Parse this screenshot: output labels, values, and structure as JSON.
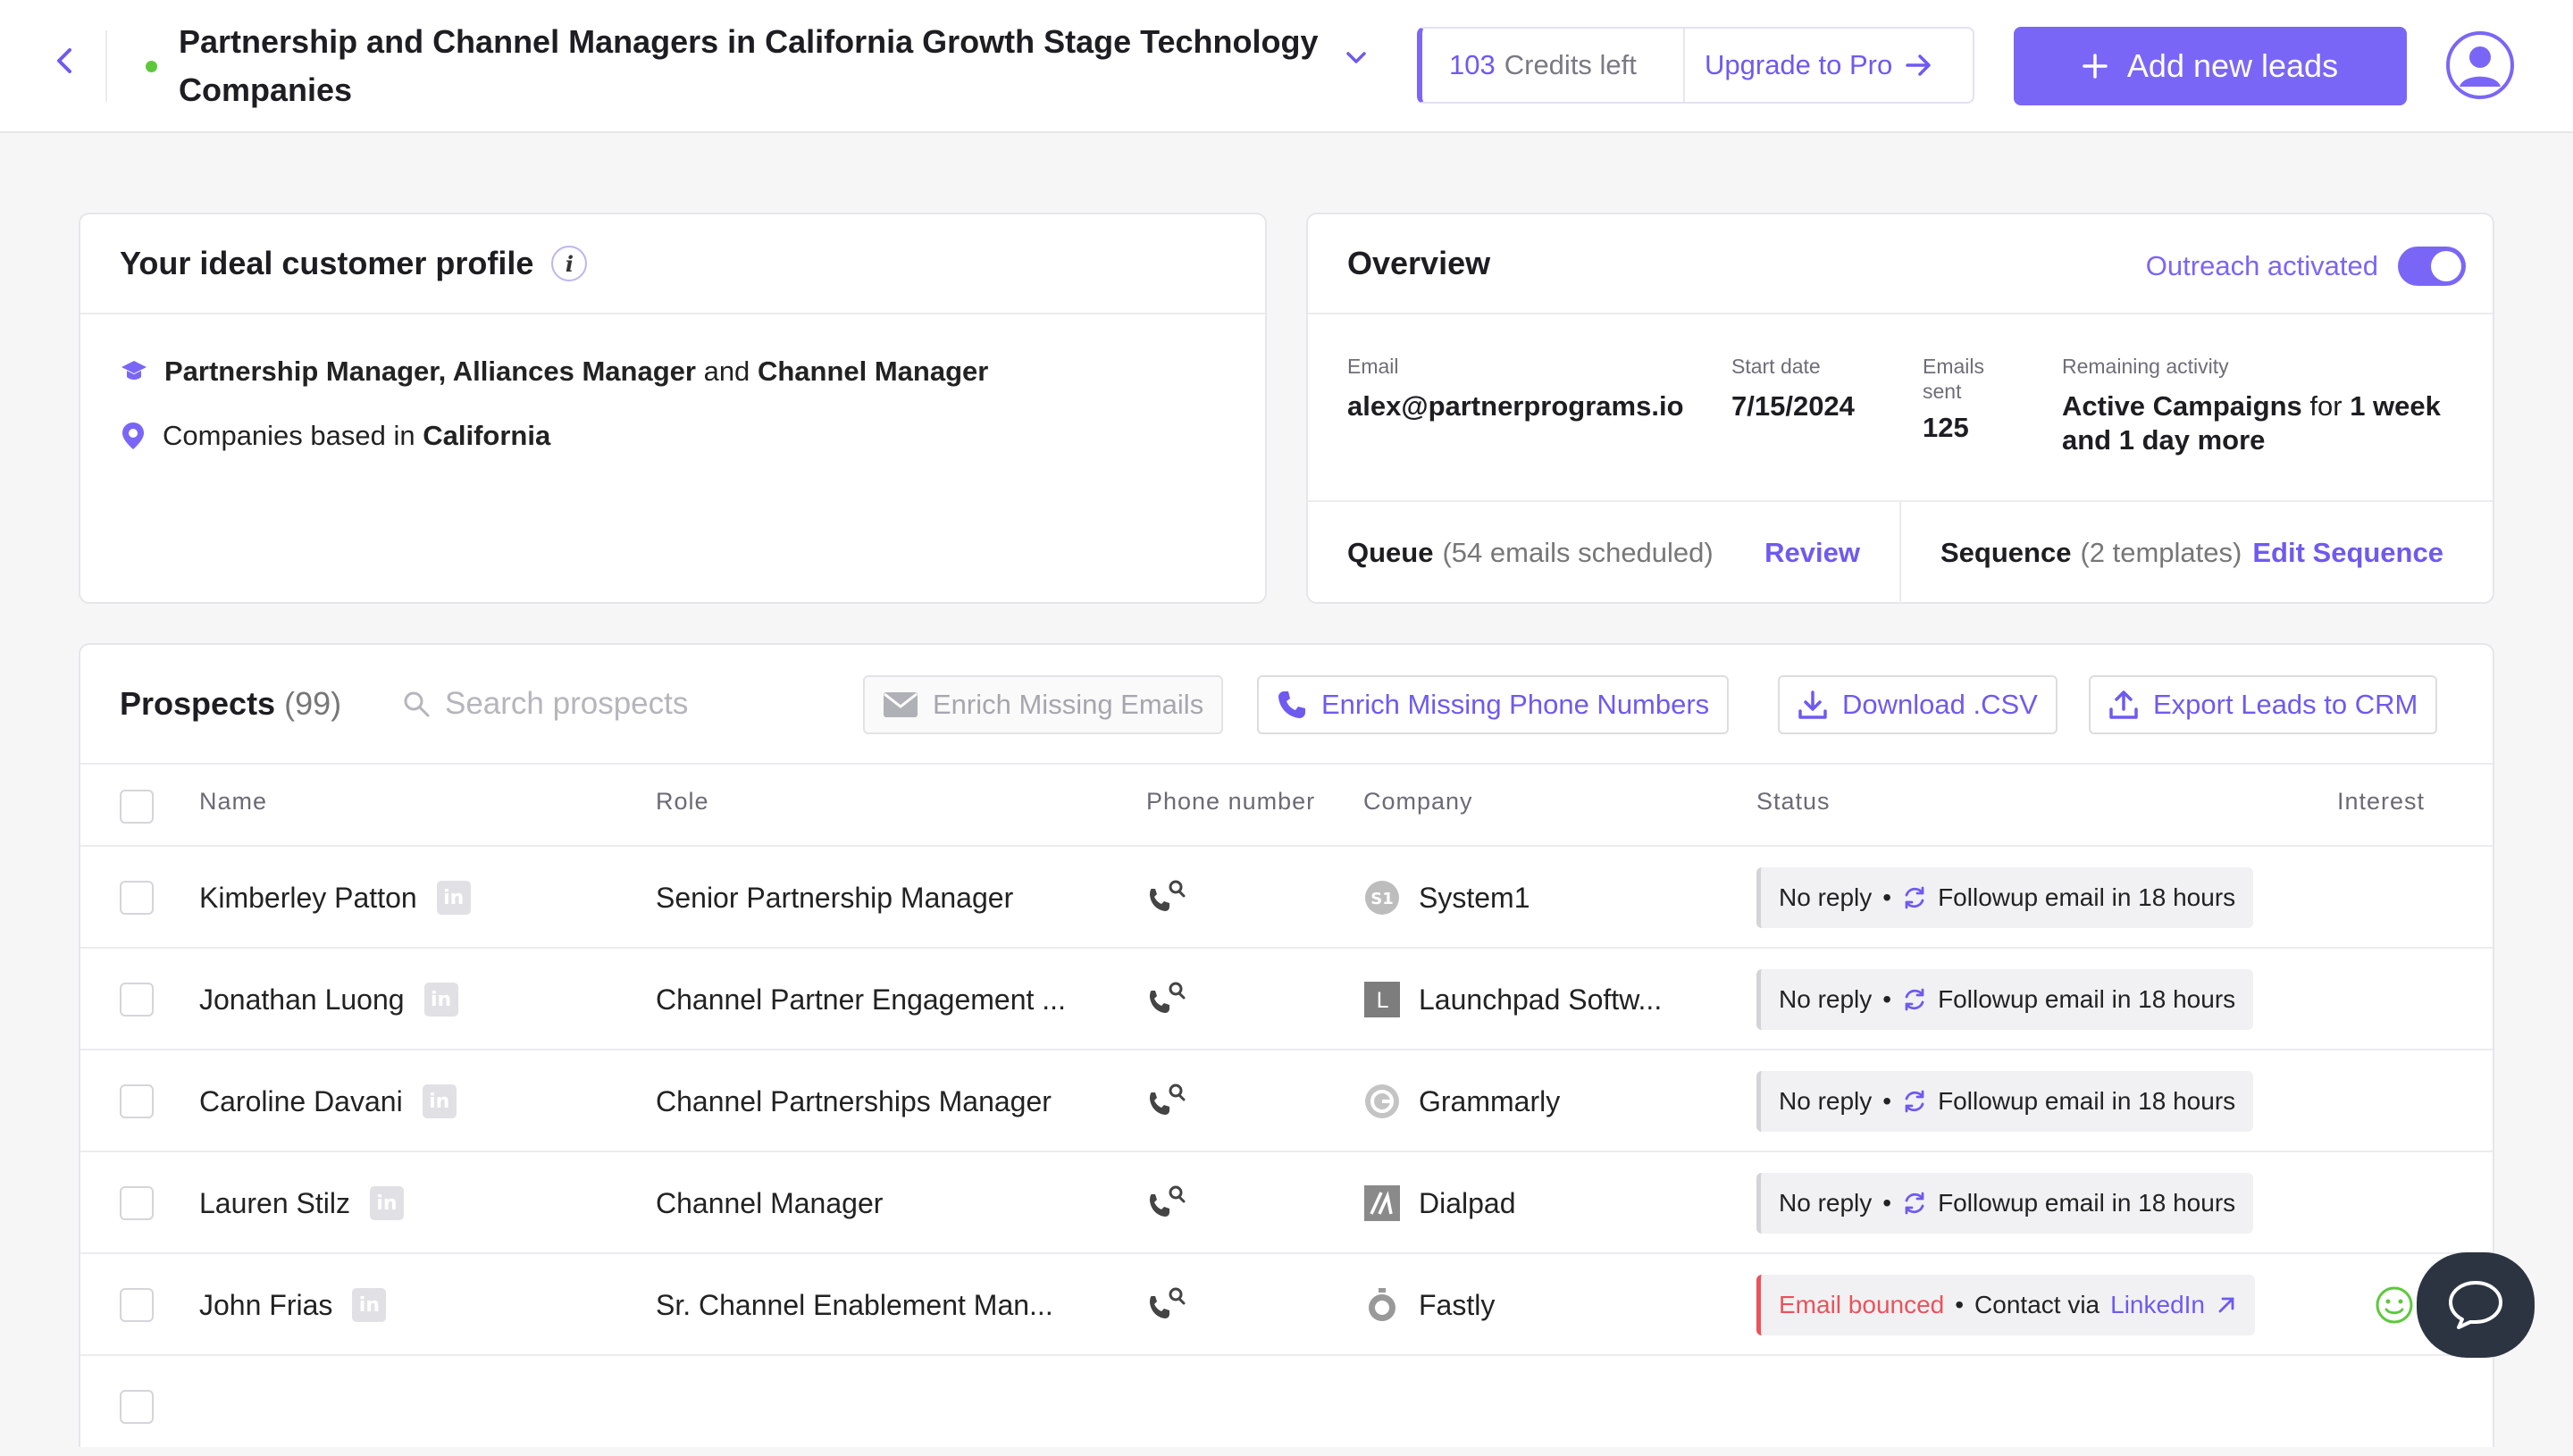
{
  "header": {
    "title": "Partnership and Channel Managers in California Growth Stage Technology Companies",
    "credits_count": "103",
    "credits_label": "Credits left",
    "upgrade_label": "Upgrade to Pro",
    "add_leads_label": "Add new leads"
  },
  "icp": {
    "title": "Your ideal customer profile",
    "roles_1": "Partnership Manager, Alliances Manager",
    "roles_and": "and",
    "roles_2": "Channel Manager",
    "companies_prefix": "Companies based in",
    "companies_location": "California"
  },
  "overview": {
    "title": "Overview",
    "outreach_label": "Outreach activated",
    "outreach_on": true,
    "email_label": "Email",
    "email_value": "alex@partnerprograms.io",
    "start_label": "Start date",
    "start_value": "7/15/2024",
    "sent_label_1": "Emails",
    "sent_label_2": "sent",
    "sent_value": "125",
    "remaining_label": "Remaining activity",
    "remaining_bold": "Active Campaigns",
    "remaining_for": "for",
    "remaining_time_1": "1 week",
    "remaining_time_2": "and 1 day more",
    "queue_label": "Queue",
    "queue_detail": "(54 emails scheduled)",
    "queue_link": "Review",
    "sequence_label": "Sequence",
    "sequence_detail": "(2 templates)",
    "sequence_link": "Edit Sequence"
  },
  "prospects": {
    "title": "Prospects",
    "count": "(99)",
    "search_placeholder": "Search prospects",
    "btn_enrich_emails": "Enrich Missing Emails",
    "btn_enrich_phones": "Enrich Missing Phone Numbers",
    "btn_download": "Download .CSV",
    "btn_export": "Export Leads to CRM",
    "columns": {
      "name": "Name",
      "role": "Role",
      "phone": "Phone number",
      "company": "Company",
      "status": "Status",
      "interest": "Interest"
    },
    "rows": [
      {
        "name": "Kimberley Patton",
        "role": "Senior Partnership Manager",
        "company": "System1",
        "status_a": "No reply",
        "status_b": "Followup email in 18 hours"
      },
      {
        "name": "Jonathan Luong",
        "role": "Channel Partner Engagement ...",
        "company": "Launchpad Softw...",
        "status_a": "No reply",
        "status_b": "Followup email in 18 hours"
      },
      {
        "name": "Caroline Davani",
        "role": "Channel Partnerships Manager",
        "company": "Grammarly",
        "status_a": "No reply",
        "status_b": "Followup email in 18 hours"
      },
      {
        "name": "Lauren Stilz",
        "role": "Channel Manager",
        "company": "Dialpad",
        "status_a": "No reply",
        "status_b": "Followup email in 18 hours"
      },
      {
        "name": "John Frias",
        "role": "Sr. Channel Enablement Man...",
        "company": "Fastly",
        "status_a": "Email bounced",
        "status_b": "Contact via",
        "status_link": "LinkedIn"
      }
    ]
  },
  "icons": {
    "back": "chevron-left-icon",
    "avatar": "user-circle-icon",
    "linkedin": "linkedin-icon",
    "phone_search": "phone-search-icon",
    "sync": "refresh-icon",
    "chat": "chat-bubble-icon"
  },
  "colors": {
    "accent": "#7a66f6",
    "online": "#5ec83c",
    "bounce": "#e9535b"
  }
}
